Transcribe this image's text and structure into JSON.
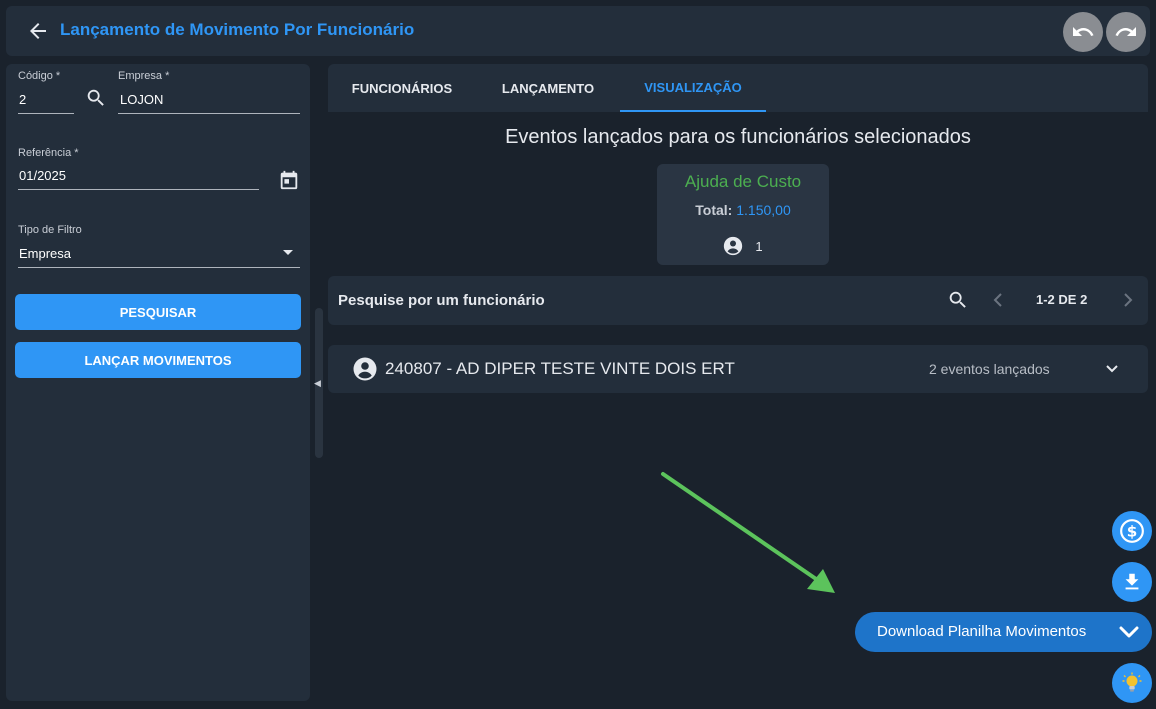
{
  "header": {
    "title": "Lançamento de Movimento Por Funcionário",
    "back_icon": "arrow-left-icon",
    "undo_icon": "undo-icon",
    "redo_icon": "redo-icon"
  },
  "form": {
    "codigo": {
      "label": "Código *",
      "value": "2"
    },
    "empresa": {
      "label": "Empresa *",
      "value": "LOJON"
    },
    "referencia": {
      "label": "Referência *",
      "value": "01/2025"
    },
    "tipo_filtro": {
      "label": "Tipo de Filtro",
      "value": "Empresa"
    },
    "pesquisar_label": "PESQUISAR",
    "lancar_label": "LANÇAR MOVIMENTOS"
  },
  "tabs": [
    {
      "label": "FUNCIONÁRIOS",
      "active": false
    },
    {
      "label": "LANÇAMENTO",
      "active": false
    },
    {
      "label": "VISUALIZAÇÃO",
      "active": true
    }
  ],
  "main": {
    "section_title": "Eventos lançados para os funcionários selecionados",
    "event_card": {
      "title": "Ajuda de Custo",
      "total_label": "Total:",
      "total_value": "1.150,00",
      "count": "1"
    },
    "search": {
      "label": "Pesquise por um funcionário",
      "pager": "1-2 DE 2"
    },
    "employee_row": {
      "name": "240807 - AD DIPER TESTE VINTE DOIS ERT",
      "events": "2 eventos lançados"
    }
  },
  "fab": {
    "download_label": "Download Planilha Movimentos"
  },
  "colors": {
    "accent": "#2f96f5",
    "success": "#4caf50",
    "background": "#1a222c",
    "panel": "#232e3b"
  }
}
